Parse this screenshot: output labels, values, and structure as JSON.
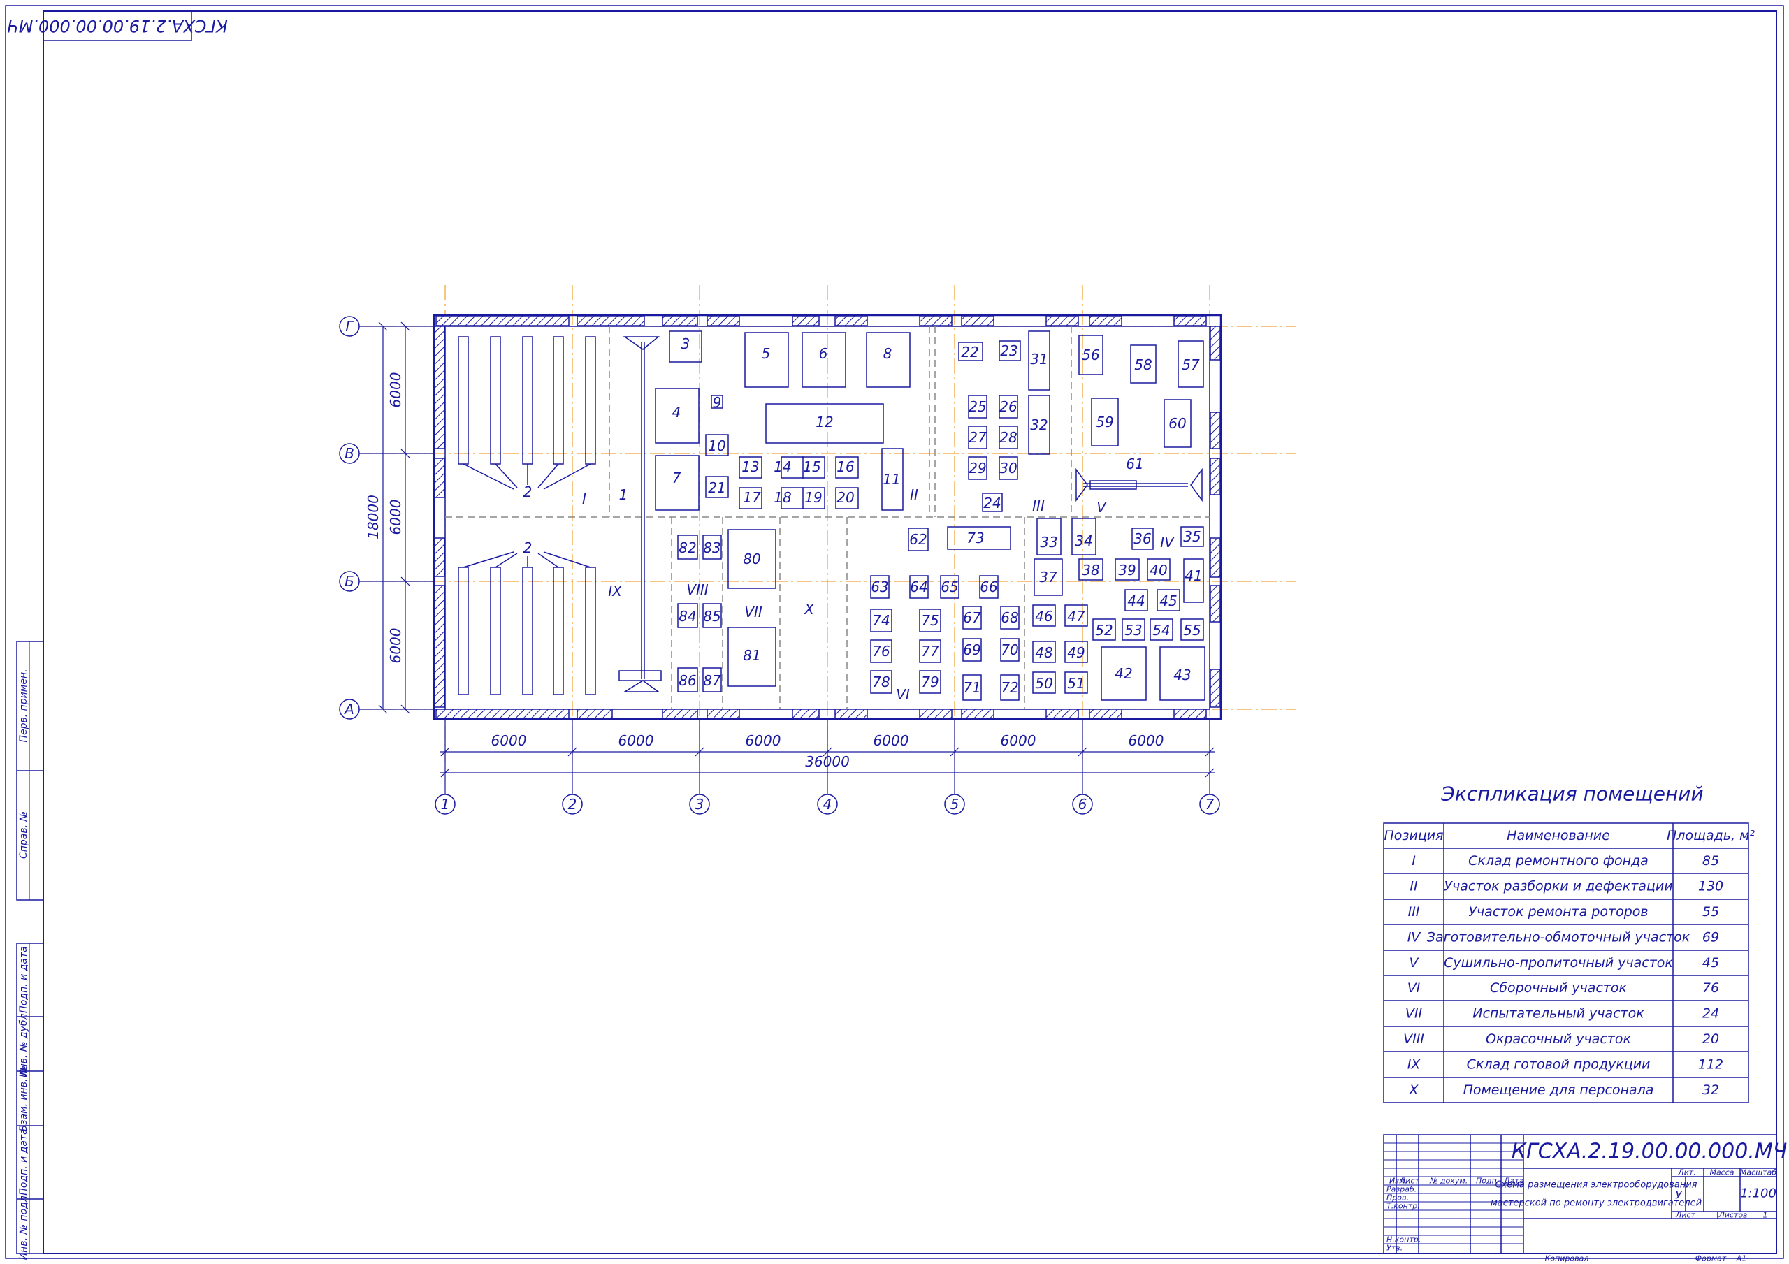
{
  "stamp_top": "КГСХА.2.19.00.00.000.МЧ",
  "plan": {
    "axes_letters": [
      "Г",
      "В",
      "Б",
      "А"
    ],
    "axes_numbers": [
      "1",
      "2",
      "3",
      "4",
      "5",
      "6",
      "7"
    ],
    "dims_vertical": [
      "6000",
      "6000",
      "6000"
    ],
    "dim_total_vertical": "18000",
    "dims_horizontal": [
      "6000",
      "6000",
      "6000",
      "6000",
      "6000",
      "6000"
    ],
    "dim_total_horizontal": "36000",
    "zones": [
      "I",
      "II",
      "III",
      "IV",
      "V",
      "VI",
      "VII",
      "VIII",
      "IX",
      "X"
    ],
    "equipment_numbers": [
      "1",
      "2",
      "2",
      "3",
      "4",
      "5",
      "6",
      "7",
      "8",
      "9",
      "10",
      "11",
      "12",
      "13",
      "14",
      "15",
      "16",
      "17",
      "18",
      "19",
      "20",
      "21",
      "22",
      "23",
      "24",
      "25",
      "26",
      "27",
      "28",
      "29",
      "30",
      "31",
      "32",
      "33",
      "34",
      "35",
      "36",
      "37",
      "38",
      "39",
      "40",
      "41",
      "42",
      "43",
      "44",
      "45",
      "46",
      "47",
      "48",
      "49",
      "50",
      "51",
      "52",
      "53",
      "54",
      "55",
      "56",
      "57",
      "58",
      "59",
      "60",
      "61",
      "62",
      "63",
      "64",
      "65",
      "66",
      "67",
      "68",
      "69",
      "70",
      "71",
      "72",
      "73",
      "74",
      "75",
      "76",
      "77",
      "78",
      "79",
      "80",
      "81",
      "82",
      "83",
      "84",
      "85",
      "86",
      "87"
    ]
  },
  "explication": {
    "title": "Экспликация помещений",
    "headers": [
      "Позиция",
      "Наименование",
      "Площадь, м²"
    ],
    "rows": [
      {
        "pos": "I",
        "name": "Склад ремонтного фонда",
        "area": "85"
      },
      {
        "pos": "II",
        "name": "Участок разборки и дефектации",
        "area": "130"
      },
      {
        "pos": "III",
        "name": "Участок ремонта роторов",
        "area": "55"
      },
      {
        "pos": "IV",
        "name": "Заготовительно-обмоточный участок",
        "area": "69"
      },
      {
        "pos": "V",
        "name": "Сушильно-пропиточный участок",
        "area": "45"
      },
      {
        "pos": "VI",
        "name": "Сборочный участок",
        "area": "76"
      },
      {
        "pos": "VII",
        "name": "Испытательный участок",
        "area": "24"
      },
      {
        "pos": "VIII",
        "name": "Окрасочный участок",
        "area": "20"
      },
      {
        "pos": "IX",
        "name": "Склад готовой продукции",
        "area": "112"
      },
      {
        "pos": "X",
        "name": "Помещение для персонала",
        "area": "32"
      }
    ]
  },
  "title_block": {
    "code": "КГСХА.2.19.00.00.000.МЧ",
    "doc_title_line1": "Схема размещения электрооборудования",
    "doc_title_line2": "мастерской по ремонту электродвигателей",
    "col_izm": "Изм.",
    "col_list": "Лист",
    "col_doc": "№ докум.",
    "col_sign": "Подп.",
    "col_date": "Дата",
    "row_razrab": "Разраб.",
    "row_prov": "Пров.",
    "row_tkontr": "Т.контр.",
    "row_nkontr": "Н.контр.",
    "row_utv": "Утв.",
    "lit_label": "Лит.",
    "lit_value": "У",
    "mass_label": "Масса",
    "scale_label": "Масштаб",
    "scale_value": "1:100",
    "sheet_label": "Лист",
    "sheets_label": "Листов",
    "sheets_value": "1",
    "copied": "Копировал",
    "format_label": "Формат",
    "format_value": "А1"
  },
  "side_stamp": {
    "perv_primen": "Перв. примен.",
    "sprav_no": "Справ. №",
    "podp_data_1": "Подп. и дата",
    "inv_dubl": "Инв. № дубл.",
    "vzam_inv": "Взам. инв. №",
    "podp_data_2": "Подп. и дата",
    "inv_podl": "Инв. № подл."
  },
  "colors": {
    "ink": "#1a1aa0",
    "axis": "#f0a030",
    "hidden": "#999999"
  }
}
